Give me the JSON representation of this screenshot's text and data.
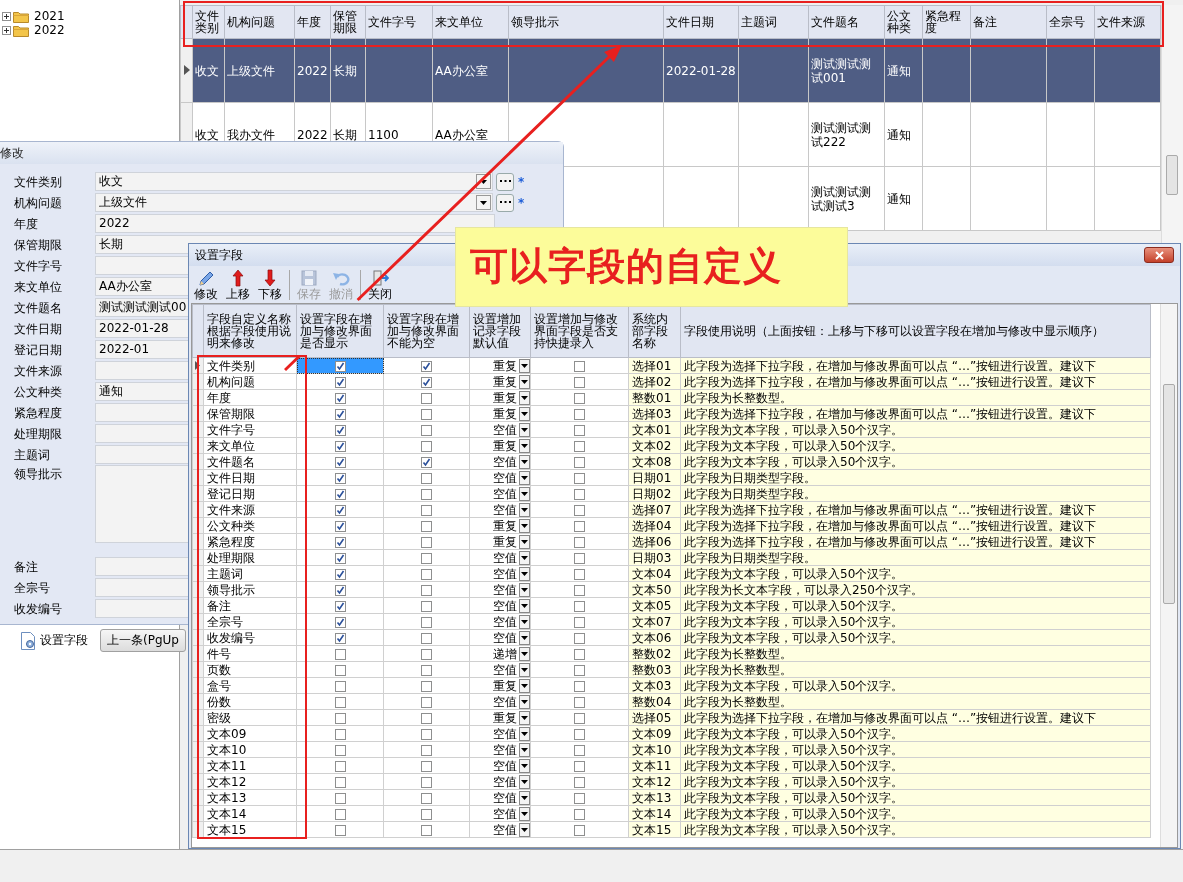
{
  "tree": [
    {
      "label": "2021",
      "expanded": false
    },
    {
      "label": "2022",
      "expanded": false
    }
  ],
  "main_grid": {
    "columns": [
      "文件类别",
      "机构问题",
      "年度",
      "保管期限",
      "文件字号",
      "来文单位",
      "领导批示",
      "文件日期",
      "主题词",
      "文件题名",
      "公文种类",
      "紧急程度",
      "备注",
      "全宗号",
      "文件来源"
    ],
    "rows": [
      {
        "selected": true,
        "cells": [
          "收文",
          "上级文件",
          "2022",
          "长期",
          null,
          "AA办公室",
          null,
          "2022-01-28",
          null,
          "测试测试测试001",
          "通知",
          null,
          null,
          null,
          null
        ]
      },
      {
        "selected": false,
        "cells": [
          "收文",
          "我办文件",
          "2022",
          "长期",
          "1100",
          "AA办公室",
          null,
          null,
          null,
          "测试测试测试222",
          "通知",
          null,
          null,
          null,
          null
        ]
      },
      {
        "selected": false,
        "cells": [
          null,
          null,
          null,
          null,
          null,
          null,
          null,
          null,
          null,
          "测试测试测试测试3",
          "通知",
          null,
          null,
          null,
          null
        ]
      }
    ]
  },
  "edit_window": {
    "title": "修改",
    "fields": [
      {
        "label": "文件类别",
        "value": "收文",
        "kind": "dropdown",
        "marker": "*"
      },
      {
        "label": "机构问题",
        "value": "上级文件",
        "kind": "dropdown",
        "marker": "*"
      },
      {
        "label": "年度",
        "value": "2022",
        "kind": "text"
      },
      {
        "label": "保管期限",
        "value": "长期",
        "kind": "text"
      },
      {
        "label": "文件字号",
        "kind": "text"
      },
      {
        "label": "来文单位",
        "value": "AA办公室",
        "kind": "text"
      },
      {
        "label": "文件题名",
        "value": "测试测试测试00",
        "kind": "text"
      },
      {
        "label": "文件日期",
        "value": "2022-01-28",
        "kind": "text"
      },
      {
        "label": "登记日期",
        "value": "2022-01",
        "kind": "text"
      },
      {
        "label": "文件来源",
        "kind": "text"
      },
      {
        "label": "公文种类",
        "value": "通知",
        "kind": "text"
      },
      {
        "label": "紧急程度",
        "kind": "text"
      },
      {
        "label": "处理期限",
        "kind": "text"
      },
      {
        "label": "主题词",
        "kind": "text"
      },
      {
        "label": "领导批示",
        "kind": "memo"
      },
      {
        "label": "备注",
        "kind": "text"
      },
      {
        "label": "全宗号",
        "kind": "text"
      },
      {
        "label": "收发编号",
        "kind": "text"
      }
    ],
    "buttons": [
      {
        "label": "设置字段",
        "kind": "settings"
      },
      {
        "label": "上一条(PgUp",
        "kind": "plain"
      }
    ]
  },
  "callout": {
    "text": "可以字段的自定义"
  },
  "settings_dialog": {
    "title": "设置字段",
    "tools": [
      {
        "label": "修改",
        "kind": "edit",
        "disabled": false,
        "separator_before": false
      },
      {
        "label": "上移",
        "kind": "up",
        "disabled": false,
        "separator_before": false
      },
      {
        "label": "下移",
        "kind": "down",
        "disabled": false,
        "separator_before": false
      },
      {
        "label": "保存",
        "kind": "save",
        "disabled": true,
        "separator_before": true
      },
      {
        "label": "撤消",
        "kind": "undo",
        "disabled": true,
        "separator_before": false
      },
      {
        "label": "关闭",
        "kind": "exit",
        "disabled": false,
        "separator_before": true
      }
    ],
    "columns": [
      "字段自定义名称根据字段使用说明来修改",
      "设置字段在增加与修改界面是否显示",
      "设置字段在增加与修改界面不能为空",
      "设置增加记录字段默认值",
      "设置增加与修改界面字段是否支持快捷录入",
      "系统内部字段名称",
      "字段使用说明（上面按钮：上移与下移可以设置字段在增加与修改中显示顺序）"
    ],
    "rows": [
      {
        "selected": true,
        "name": "文件类别",
        "shown": true,
        "required": true,
        "default": "重复",
        "quick": false,
        "internal": "选择01",
        "description": "此字段为选择下拉字段，在增加与修改界面可以点 “…”按钮进行设置。建议下"
      },
      {
        "selected": false,
        "name": "机构问题",
        "shown": true,
        "required": true,
        "default": "重复",
        "quick": false,
        "internal": "选择02",
        "description": "此字段为选择下拉字段，在增加与修改界面可以点 “…”按钮进行设置。建议下"
      },
      {
        "selected": false,
        "name": "年度",
        "shown": true,
        "required": false,
        "default": "重复",
        "quick": false,
        "internal": "整数01",
        "description": "此字段为长整数型。"
      },
      {
        "selected": false,
        "name": "保管期限",
        "shown": true,
        "required": false,
        "default": "重复",
        "quick": false,
        "internal": "选择03",
        "description": "此字段为选择下拉字段，在增加与修改界面可以点 “…”按钮进行设置。建议下"
      },
      {
        "selected": false,
        "name": "文件字号",
        "shown": true,
        "required": false,
        "default": "空值",
        "quick": false,
        "internal": "文本01",
        "description": "此字段为文本字段，可以录入50个汉字。"
      },
      {
        "selected": false,
        "name": "来文单位",
        "shown": true,
        "required": false,
        "default": "重复",
        "quick": false,
        "internal": "文本02",
        "description": "此字段为文本字段，可以录入50个汉字。"
      },
      {
        "selected": false,
        "name": "文件题名",
        "shown": true,
        "required": true,
        "default": "空值",
        "quick": false,
        "internal": "文本08",
        "description": "此字段为文本字段，可以录入50个汉字。"
      },
      {
        "selected": false,
        "name": "文件日期",
        "shown": true,
        "required": false,
        "default": "空值",
        "quick": false,
        "internal": "日期01",
        "description": "此字段为日期类型字段。"
      },
      {
        "selected": false,
        "name": "登记日期",
        "shown": true,
        "required": false,
        "default": "空值",
        "quick": false,
        "internal": "日期02",
        "description": "此字段为日期类型字段。"
      },
      {
        "selected": false,
        "name": "文件来源",
        "shown": true,
        "required": false,
        "default": "空值",
        "quick": false,
        "internal": "选择07",
        "description": "此字段为选择下拉字段，在增加与修改界面可以点 “…”按钮进行设置。建议下"
      },
      {
        "selected": false,
        "name": "公文种类",
        "shown": true,
        "required": false,
        "default": "重复",
        "quick": false,
        "internal": "选择04",
        "description": "此字段为选择下拉字段，在增加与修改界面可以点 “…”按钮进行设置。建议下"
      },
      {
        "selected": false,
        "name": "紧急程度",
        "shown": true,
        "required": false,
        "default": "重复",
        "quick": false,
        "internal": "选择06",
        "description": "此字段为选择下拉字段，在增加与修改界面可以点 “…”按钮进行设置。建议下"
      },
      {
        "selected": false,
        "name": "处理期限",
        "shown": true,
        "required": false,
        "default": "空值",
        "quick": false,
        "internal": "日期03",
        "description": "此字段为日期类型字段。"
      },
      {
        "selected": false,
        "name": "主题词",
        "shown": true,
        "required": false,
        "default": "空值",
        "quick": false,
        "internal": "文本04",
        "description": "此字段为文本字段，可以录入50个汉字。"
      },
      {
        "selected": false,
        "name": "领导批示",
        "shown": true,
        "required": false,
        "default": "空值",
        "quick": false,
        "internal": "文本50",
        "description": "此字段为长文本字段，可以录入250个汉字。"
      },
      {
        "selected": false,
        "name": "备注",
        "shown": true,
        "required": false,
        "default": "空值",
        "quick": false,
        "internal": "文本05",
        "description": "此字段为文本字段，可以录入50个汉字。"
      },
      {
        "selected": false,
        "name": "全宗号",
        "shown": true,
        "required": false,
        "default": "空值",
        "quick": false,
        "internal": "文本07",
        "description": "此字段为文本字段，可以录入50个汉字。"
      },
      {
        "selected": false,
        "name": "收发编号",
        "shown": true,
        "required": false,
        "default": "空值",
        "quick": false,
        "internal": "文本06",
        "description": "此字段为文本字段，可以录入50个汉字。"
      },
      {
        "selected": false,
        "name": "件号",
        "shown": false,
        "required": false,
        "default": "递增",
        "quick": false,
        "internal": "整数02",
        "description": "此字段为长整数型。"
      },
      {
        "selected": false,
        "name": "页数",
        "shown": false,
        "required": false,
        "default": "空值",
        "quick": false,
        "internal": "整数03",
        "description": "此字段为长整数型。"
      },
      {
        "selected": false,
        "name": "盒号",
        "shown": false,
        "required": false,
        "default": "重复",
        "quick": false,
        "internal": "文本03",
        "description": "此字段为文本字段，可以录入50个汉字。"
      },
      {
        "selected": false,
        "name": "份数",
        "shown": false,
        "required": false,
        "default": "空值",
        "quick": false,
        "internal": "整数04",
        "description": "此字段为长整数型。"
      },
      {
        "selected": false,
        "name": "密级",
        "shown": false,
        "required": false,
        "default": "重复",
        "quick": false,
        "internal": "选择05",
        "description": "此字段为选择下拉字段，在增加与修改界面可以点 “…”按钮进行设置。建议下"
      },
      {
        "selected": false,
        "name": "文本09",
        "shown": false,
        "required": false,
        "default": "空值",
        "quick": false,
        "internal": "文本09",
        "description": "此字段为文本字段，可以录入50个汉字。"
      },
      {
        "selected": false,
        "name": "文本10",
        "shown": false,
        "required": false,
        "default": "空值",
        "quick": false,
        "internal": "文本10",
        "description": "此字段为文本字段，可以录入50个汉字。"
      },
      {
        "selected": false,
        "name": "文本11",
        "shown": false,
        "required": false,
        "default": "空值",
        "quick": false,
        "internal": "文本11",
        "description": "此字段为文本字段，可以录入50个汉字。"
      },
      {
        "selected": false,
        "name": "文本12",
        "shown": false,
        "required": false,
        "default": "空值",
        "quick": false,
        "internal": "文本12",
        "description": "此字段为文本字段，可以录入50个汉字。"
      },
      {
        "selected": false,
        "name": "文本13",
        "shown": false,
        "required": false,
        "default": "空值",
        "quick": false,
        "internal": "文本13",
        "description": "此字段为文本字段，可以录入50个汉字。"
      },
      {
        "selected": false,
        "name": "文本14",
        "shown": false,
        "required": false,
        "default": "空值",
        "quick": false,
        "internal": "文本14",
        "description": "此字段为文本字段，可以录入50个汉字。"
      },
      {
        "selected": false,
        "name": "文本15",
        "shown": false,
        "required": false,
        "default": "空值",
        "quick": false,
        "internal": "文本15",
        "description": "此字段为文本字段，可以录入50个汉字。"
      }
    ]
  }
}
